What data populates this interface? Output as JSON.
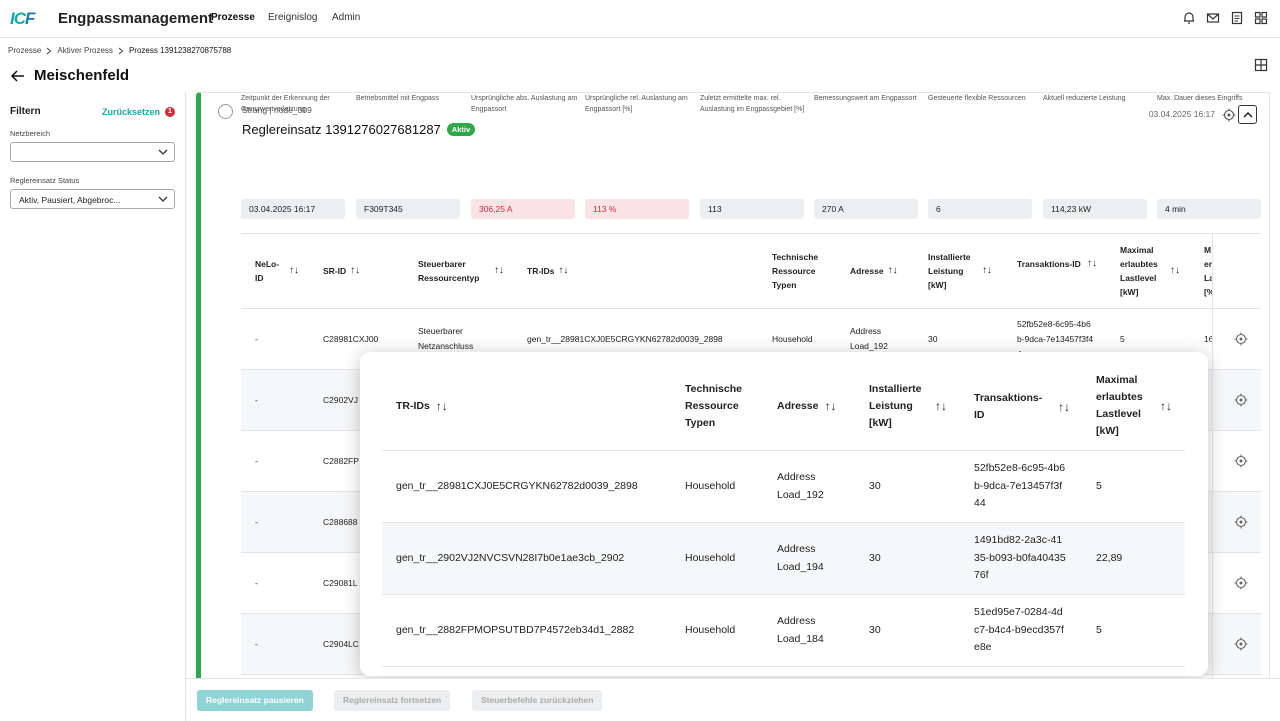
{
  "app": {
    "name": "Engpassmanagement",
    "logo_a": "IC",
    "logo_b": "F"
  },
  "nav": [
    "Prozesse",
    "Ereignislog",
    "Admin"
  ],
  "breadcrumb": [
    "Prozesse",
    "Aktiver Prozess",
    "Prozess 1391238270875788"
  ],
  "page_title": "Meischenfeld",
  "filter": {
    "title": "Filtern",
    "reset": "Zurücksetzen",
    "badge": "1",
    "netz_label": "Netzbereich",
    "netz_value": "",
    "status_label": "Reglereinsatz Status",
    "status_value": "Aktiv, Pausiert, Abgebroc..."
  },
  "card": {
    "strang": "Strang | node_309",
    "title": "Reglereinsatz 1391276027681287",
    "status": "Aktiv",
    "date": "03.04.2025 16:17"
  },
  "metrics": [
    {
      "label": "Zeitpunkt der Erkennung der Grenzwertverletzung",
      "value": "03.04.2025 16:17",
      "alert": false
    },
    {
      "label": "Betriebsmittel mit Engpass",
      "value": "F309T345",
      "alert": false
    },
    {
      "label": "Ursprüngliche abs. Auslastung am Engpassort",
      "value": "306,25 A",
      "alert": true
    },
    {
      "label": "Ursprüngliche rel. Auslastung am Engpassort [%]",
      "value": "113 %",
      "alert": true
    },
    {
      "label": "Zuletzt ermittelte max. rel. Auslastung im Engpassgebiet [%]",
      "value": "113",
      "alert": false
    },
    {
      "label": "Bemessungswert am Engpassort",
      "value": "270 A",
      "alert": false
    },
    {
      "label": "Gesteuerte flexible Ressourcen",
      "value": "6",
      "alert": false
    },
    {
      "label": "Aktuell reduzierte Leistung",
      "value": "114,23 kW",
      "alert": false
    },
    {
      "label": "Max. Dauer dieses Eingriffs",
      "value": "4 min",
      "alert": false
    }
  ],
  "table": {
    "headers": [
      "NeLo-ID",
      "SR-ID",
      "Steuerbarer Ressourcentyp",
      "TR-IDs",
      "Technische Ressource Typen",
      "Adresse",
      "Installierte Leistung [kW]",
      "Transaktions-ID",
      "Maximal erlaubtes Lastlevel [kW]",
      "M er La [%"
    ],
    "rows": [
      {
        "nelo": "-",
        "sr": "C28981CXJ00",
        "typ": "Steuerbarer Netzanschluss",
        "tr": "gen_tr__28981CXJ0E5CRGYKN62782d0039_2898",
        "ttyp": "Household",
        "adr": "Address Load_192",
        "inst": "30",
        "tx": "52fb52e8-6c95-4b6b-9dca-7e13457f3f44",
        "max": "5",
        "last": "16"
      },
      {
        "nelo": "-",
        "sr": "C2902VJ"
      },
      {
        "nelo": "-",
        "sr": "C2882FP"
      },
      {
        "nelo": "-",
        "sr": "C288688"
      },
      {
        "nelo": "-",
        "sr": "C29081L"
      },
      {
        "nelo": "-",
        "sr": "C2904LC"
      }
    ]
  },
  "popup": {
    "headers": [
      "TR-IDs",
      "Technische Ressource Typen",
      "Adresse",
      "Installierte Leistung [kW]",
      "Transaktions-ID",
      "Maximal erlaubtes Lastlevel [kW]"
    ],
    "rows": [
      {
        "tr": "gen_tr__28981CXJ0E5CRGYKN62782d0039_2898",
        "typ": "Household",
        "adr": "Address Load_192",
        "inst": "30",
        "tx": "52fb52e8-6c95-4b6b-9dca-7e13457f3f44",
        "max": "5"
      },
      {
        "tr": "gen_tr__2902VJ2NVCSVN28I7b0e1ae3cb_2902",
        "typ": "Household",
        "adr": "Address Load_194",
        "inst": "30",
        "tx": "1491bd82-2a3c-4135-b093-b0fa4043576f",
        "max": "22,89"
      },
      {
        "tr": "gen_tr__2882FPMOPSUTBD7P4572eb34d1_2882",
        "typ": "Household",
        "adr": "Address Load_184",
        "inst": "30",
        "tx": "51ed95e7-0284-4dc7-b4c4-b9ecd357fe8e",
        "max": "5"
      }
    ]
  },
  "footer": [
    "Reglereinsatz pausieren",
    "Reglereinsatz fortsetzen",
    "Steuerbefehle zurückziehen"
  ],
  "colors": {
    "accent": "#1aa7a7",
    "active": "#2ea84a",
    "alert": "#d6283b"
  }
}
